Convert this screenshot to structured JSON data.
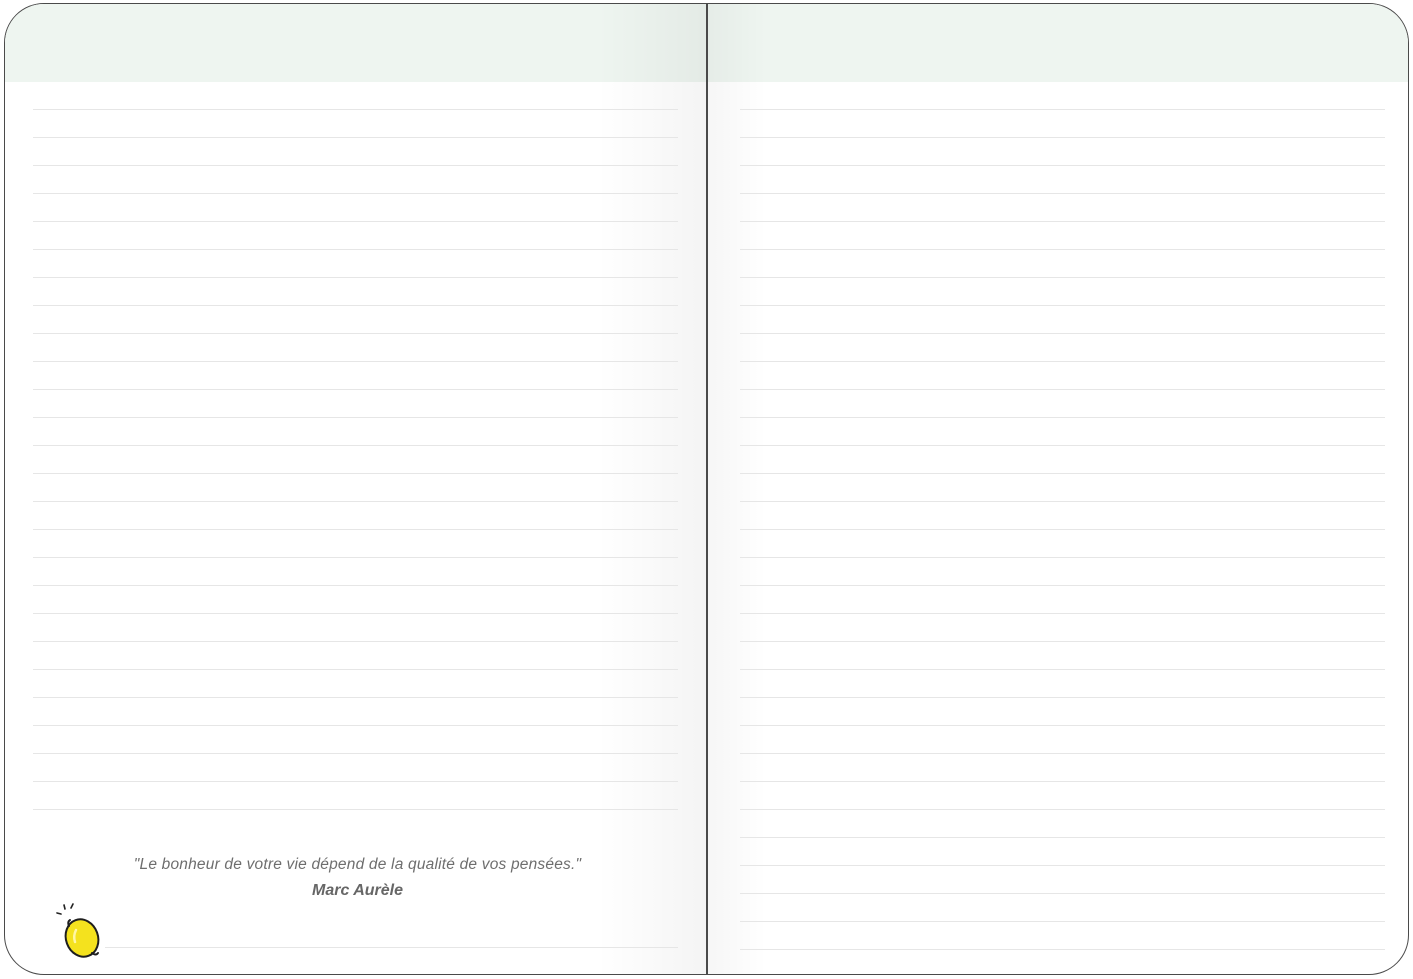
{
  "quote": {
    "text": "\"Le bonheur de votre vie dépend de la qualité de vos pensées.\"",
    "author": "Marc Aurèle"
  },
  "icons": {
    "lemon": "lemon-icon"
  },
  "colors": {
    "header_band": "#eef5f0",
    "rule_lines": "#e6e6e6",
    "outline": "#4a4a4a",
    "lemon": "#f4e21e"
  }
}
